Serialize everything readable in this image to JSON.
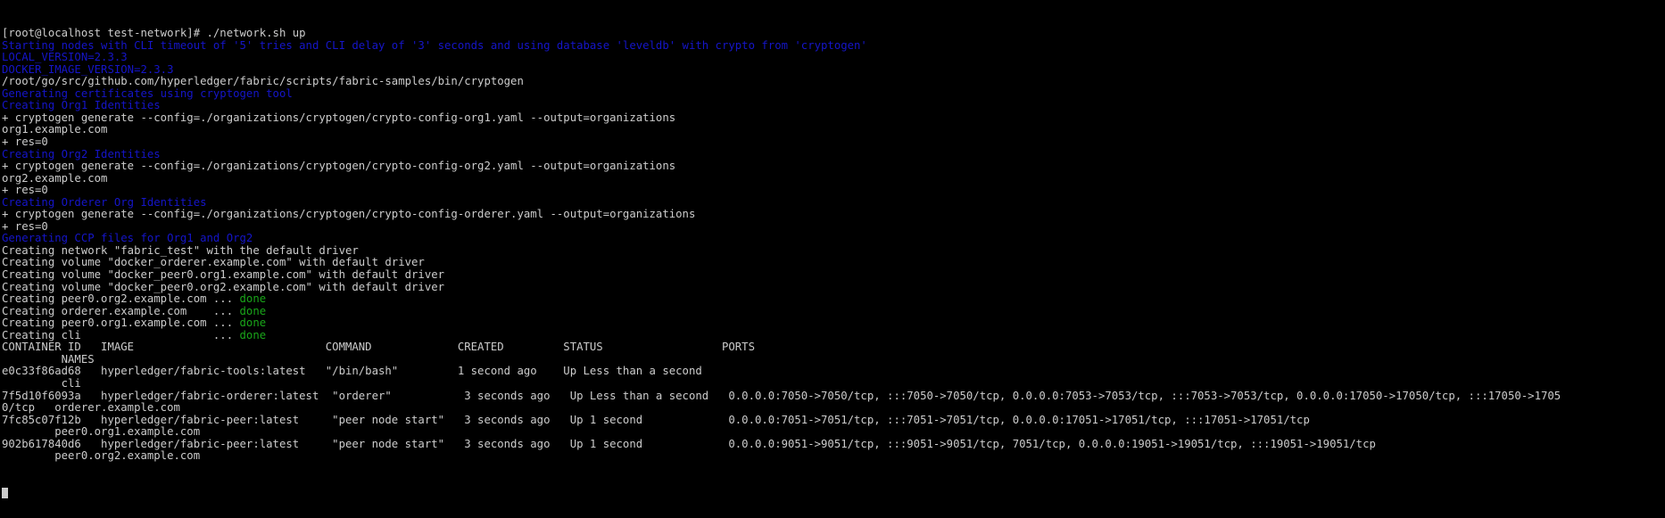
{
  "terminal": {
    "colors": {
      "background": "#000000",
      "default_fg": "#cccccc",
      "blue": "#1515c9",
      "green": "#19a519"
    },
    "prompt": {
      "user": "root",
      "host": "localhost",
      "cwd": "test-network",
      "symbol": "#",
      "full": "[root@localhost test-network]#",
      "command": " ./network.sh up"
    },
    "lines": [
      {
        "text": "[root@localhost test-network]# ./network.sh up",
        "color": "default"
      },
      {
        "text": "Starting nodes with CLI timeout of '5' tries and CLI delay of '3' seconds and using database 'leveldb' with crypto from 'cryptogen'",
        "color": "blue"
      },
      {
        "text": "LOCAL_VERSION=2.3.3",
        "color": "blue"
      },
      {
        "text": "DOCKER_IMAGE_VERSION=2.3.3",
        "color": "blue"
      },
      {
        "text": "/root/go/src/github.com/hyperledger/fabric/scripts/fabric-samples/bin/cryptogen",
        "color": "default"
      },
      {
        "text": "Generating certificates using cryptogen tool",
        "color": "blue"
      },
      {
        "text": "Creating Org1 Identities",
        "color": "blue"
      },
      {
        "text": "+ cryptogen generate --config=./organizations/cryptogen/crypto-config-org1.yaml --output=organizations",
        "color": "default"
      },
      {
        "text": "org1.example.com",
        "color": "default"
      },
      {
        "text": "+ res=0",
        "color": "default"
      },
      {
        "text": "Creating Org2 Identities",
        "color": "blue"
      },
      {
        "text": "+ cryptogen generate --config=./organizations/cryptogen/crypto-config-org2.yaml --output=organizations",
        "color": "default"
      },
      {
        "text": "org2.example.com",
        "color": "default"
      },
      {
        "text": "+ res=0",
        "color": "default"
      },
      {
        "text": "Creating Orderer Org Identities",
        "color": "blue"
      },
      {
        "text": "+ cryptogen generate --config=./organizations/cryptogen/crypto-config-orderer.yaml --output=organizations",
        "color": "default"
      },
      {
        "text": "+ res=0",
        "color": "default"
      },
      {
        "text": "Generating CCP files for Org1 and Org2",
        "color": "blue"
      },
      {
        "text": "Creating network \"fabric_test\" with the default driver",
        "color": "default"
      },
      {
        "text": "Creating volume \"docker_orderer.example.com\" with default driver",
        "color": "default"
      },
      {
        "text": "Creating volume \"docker_peer0.org1.example.com\" with default driver",
        "color": "default"
      },
      {
        "text": "Creating volume \"docker_peer0.org2.example.com\" with default driver",
        "color": "default"
      },
      {
        "text": "Creating peer0.org2.example.com ... ",
        "color": "default",
        "suffix": "done",
        "suffix_color": "green"
      },
      {
        "text": "Creating orderer.example.com    ... ",
        "color": "default",
        "suffix": "done",
        "suffix_color": "green"
      },
      {
        "text": "Creating peer0.org1.example.com ... ",
        "color": "default",
        "suffix": "done",
        "suffix_color": "green"
      },
      {
        "text": "Creating cli                    ... ",
        "color": "default",
        "suffix": "done",
        "suffix_color": "green"
      },
      {
        "text": "CONTAINER ID   IMAGE                             COMMAND             CREATED         STATUS                  PORTS",
        "color": "default"
      },
      {
        "text": "         NAMES",
        "color": "default"
      },
      {
        "text": "e0c33f86ad68   hyperledger/fabric-tools:latest   \"/bin/bash\"         1 second ago    Up Less than a second",
        "color": "default"
      },
      {
        "text": "         cli",
        "color": "default"
      },
      {
        "text": "7f5d10f6093a   hyperledger/fabric-orderer:latest  \"orderer\"           3 seconds ago   Up Less than a second   0.0.0.0:7050->7050/tcp, :::7050->7050/tcp, 0.0.0.0:7053->7053/tcp, :::7053->7053/tcp, 0.0.0.0:17050->17050/tcp, :::17050->1705",
        "color": "default"
      },
      {
        "text": "0/tcp   orderer.example.com",
        "color": "default"
      },
      {
        "text": "7fc85c07f12b   hyperledger/fabric-peer:latest     \"peer node start\"   3 seconds ago   Up 1 second             0.0.0.0:7051->7051/tcp, :::7051->7051/tcp, 0.0.0.0:17051->17051/tcp, :::17051->17051/tcp",
        "color": "default"
      },
      {
        "text": "        peer0.org1.example.com",
        "color": "default"
      },
      {
        "text": "902b617840d6   hyperledger/fabric-peer:latest     \"peer node start\"   3 seconds ago   Up 1 second             0.0.0.0:9051->9051/tcp, :::9051->9051/tcp, 7051/tcp, 0.0.0.0:19051->19051/tcp, :::19051->19051/tcp",
        "color": "default"
      },
      {
        "text": "        peer0.org2.example.com",
        "color": "default"
      }
    ],
    "table_headers": [
      "CONTAINER ID",
      "IMAGE",
      "COMMAND",
      "CREATED",
      "STATUS",
      "PORTS",
      "NAMES"
    ],
    "containers": [
      {
        "id": "e0c33f86ad68",
        "image": "hyperledger/fabric-tools:latest",
        "command": "\"/bin/bash\"",
        "created": "1 second ago",
        "status": "Up Less than a second",
        "ports": "",
        "names": "cli"
      },
      {
        "id": "7f5d10f6093a",
        "image": "hyperledger/fabric-orderer:latest",
        "command": "\"orderer\"",
        "created": "3 seconds ago",
        "status": "Up Less than a second",
        "ports": "0.0.0.0:7050->7050/tcp, :::7050->7050/tcp, 0.0.0.0:7053->7053/tcp, :::7053->7053/tcp, 0.0.0.0:17050->17050/tcp, :::17050->17050/tcp",
        "names": "orderer.example.com"
      },
      {
        "id": "7fc85c07f12b",
        "image": "hyperledger/fabric-peer:latest",
        "command": "\"peer node start\"",
        "created": "3 seconds ago",
        "status": "Up 1 second",
        "ports": "0.0.0.0:7051->7051/tcp, :::7051->7051/tcp, 0.0.0.0:17051->17051/tcp, :::17051->17051/tcp",
        "names": "peer0.org1.example.com"
      },
      {
        "id": "902b617840d6",
        "image": "hyperledger/fabric-peer:latest",
        "command": "\"peer node start\"",
        "created": "3 seconds ago",
        "status": "Up 1 second",
        "ports": "0.0.0.0:9051->9051/tcp, :::9051->9051/tcp, 7051/tcp, 0.0.0.0:19051->19051/tcp, :::19051->19051/tcp",
        "names": "peer0.org2.example.com"
      }
    ],
    "cursor_visible": true
  }
}
